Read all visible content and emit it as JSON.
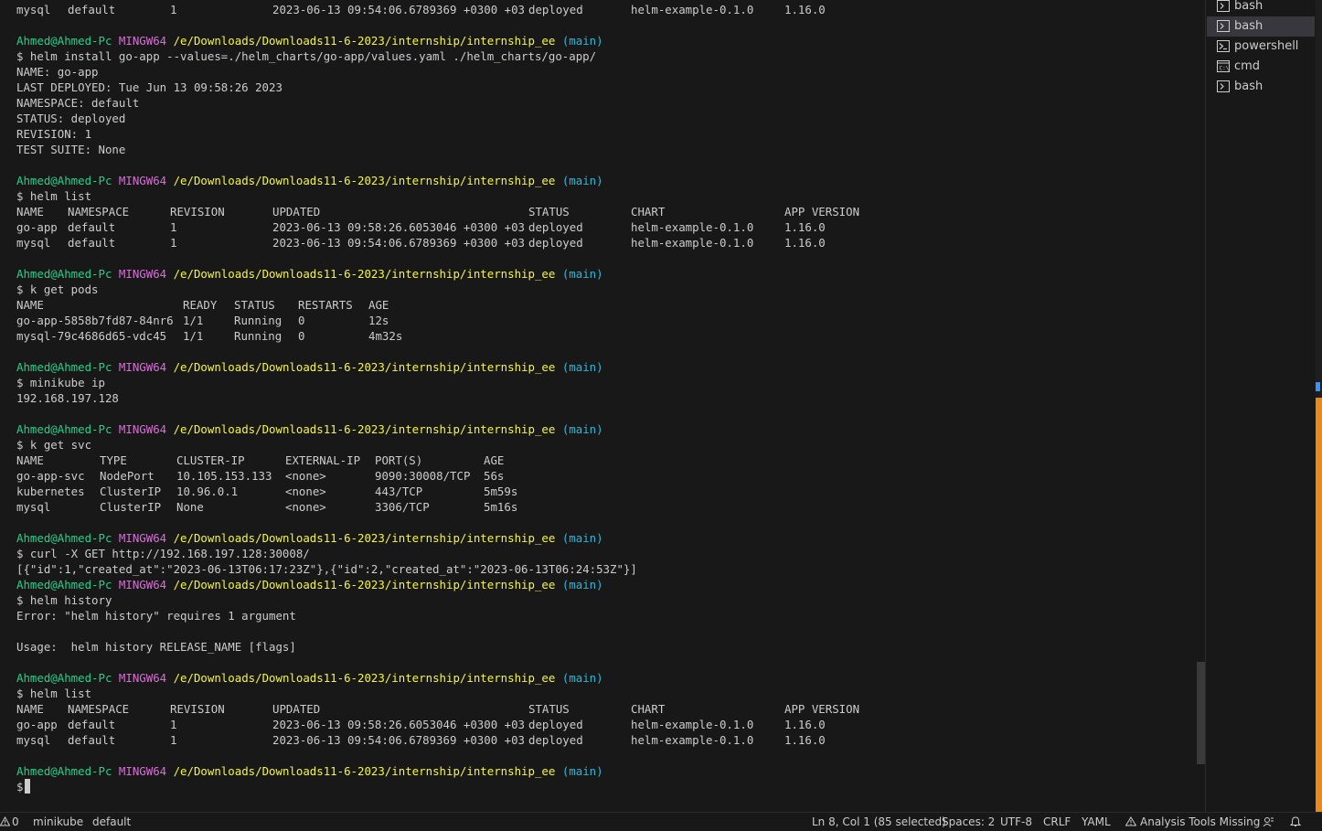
{
  "prompt": {
    "user": "Ahmed@Ahmed-Pc",
    "system": "MINGW64",
    "path": "/e/Downloads/Downloads11-6-2023/internship/internship_ee",
    "branch": "(main)"
  },
  "terminal": {
    "top_row": [
      "mysql",
      "default",
      "1",
      "2023-06-13 09:54:06.6789369 +0300 +03",
      "deployed",
      "helm-example-0.1.0",
      "1.16.0"
    ],
    "cmd_install": "$ helm install go-app --values=./helm_charts/go-app/values.yaml ./helm_charts/go-app/",
    "install_out": [
      "NAME: go-app",
      "LAST DEPLOYED: Tue Jun 13 09:58:26 2023",
      "NAMESPACE: default",
      "STATUS: deployed",
      "REVISION: 1",
      "TEST SUITE: None"
    ],
    "cmd_helm_list": "$ helm list",
    "helm_list_header": [
      "NAME",
      "NAMESPACE",
      "REVISION",
      "UPDATED",
      "STATUS",
      "CHART",
      "APP VERSION"
    ],
    "helm_list_rows": [
      [
        "go-app",
        "default",
        "1",
        "2023-06-13 09:58:26.6053046 +0300 +03",
        "deployed",
        "helm-example-0.1.0",
        "1.16.0"
      ],
      [
        "mysql",
        "default",
        "1",
        "2023-06-13 09:54:06.6789369 +0300 +03",
        "deployed",
        "helm-example-0.1.0",
        "1.16.0"
      ]
    ],
    "cmd_get_pods": "$ k get pods",
    "pods_header": [
      "NAME",
      "READY",
      "STATUS",
      "RESTARTS",
      "AGE"
    ],
    "pods_rows": [
      [
        "go-app-5858b7fd87-84nr6",
        "1/1",
        "Running",
        "0",
        "12s"
      ],
      [
        "mysql-79c4686d65-vdc45",
        "1/1",
        "Running",
        "0",
        "4m32s"
      ]
    ],
    "cmd_minikube_ip": "$ minikube ip",
    "minikube_ip_out": "192.168.197.128",
    "cmd_get_svc": "$ k get svc",
    "svc_header": [
      "NAME",
      "TYPE",
      "CLUSTER-IP",
      "EXTERNAL-IP",
      "PORT(S)",
      "AGE"
    ],
    "svc_rows": [
      [
        "go-app-svc",
        "NodePort",
        "10.105.153.133",
        "<none>",
        "9090:30008/TCP",
        "56s"
      ],
      [
        "kubernetes",
        "ClusterIP",
        "10.96.0.1",
        "<none>",
        "443/TCP",
        "5m59s"
      ],
      [
        "mysql",
        "ClusterIP",
        "None",
        "<none>",
        "3306/TCP",
        "5m16s"
      ]
    ],
    "cmd_curl": "$ curl -X GET http://192.168.197.128:30008/",
    "curl_out": "[{\"id\":1,\"created_at\":\"2023-06-13T06:17:23Z\"},{\"id\":2,\"created_at\":\"2023-06-13T06:24:53Z\"}]",
    "cmd_history": "$ helm history",
    "history_error": "Error: \"helm history\" requires 1 argument",
    "history_usage": "Usage:  helm history RELEASE_NAME [flags]",
    "final_prompt": "$"
  },
  "tabs": [
    {
      "label": "bash",
      "icon": "bash-icon",
      "active": false
    },
    {
      "label": "bash",
      "icon": "bash-icon",
      "active": true
    },
    {
      "label": "powershell",
      "icon": "powershell-icon",
      "active": false
    },
    {
      "label": "cmd",
      "icon": "cmd-icon",
      "active": false
    },
    {
      "label": "bash",
      "icon": "bash-icon",
      "active": false
    }
  ],
  "status": {
    "problems": "0",
    "context": "minikube",
    "namespace": "default",
    "position": "Ln 8, Col 1 (85 selected)",
    "spaces": "Spaces: 2",
    "encoding": "UTF-8",
    "eol": "CRLF",
    "language": "YAML",
    "analysis": "Analysis Tools Missing"
  },
  "colors": {
    "user": "#23d18b",
    "system": "#d670d6",
    "path": "#f5f543",
    "branch": "#29b8db",
    "accent": "#e8891f"
  }
}
